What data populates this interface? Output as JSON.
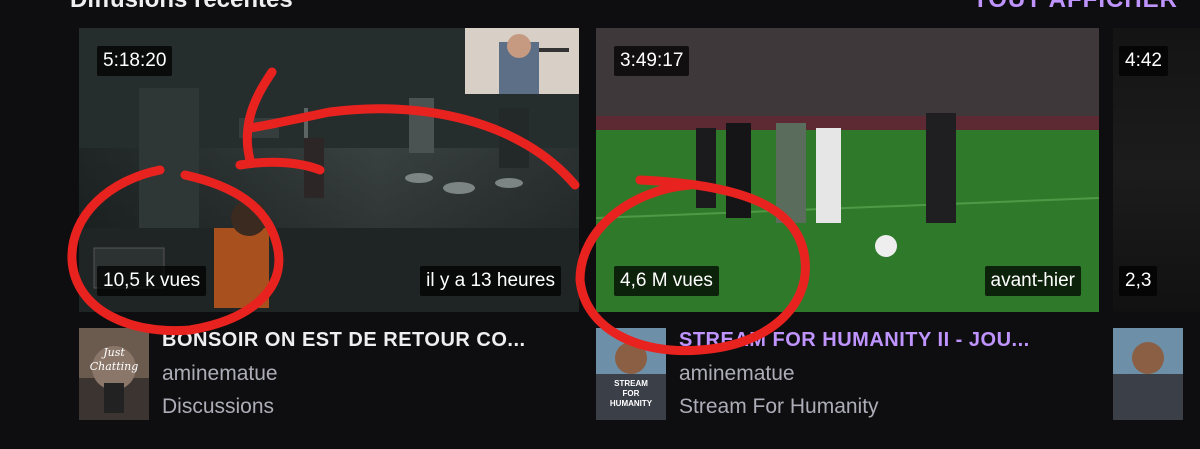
{
  "section": {
    "title": "Diffusions récentes",
    "see_all": "TOUT AFFICHER"
  },
  "videos": [
    {
      "duration": "5:18:20",
      "views": "10,5 k vues",
      "date": "il y a 13 heures",
      "title": "BONSOIR ON EST DE RETOUR CO...",
      "channel": "aminematue",
      "category": "Discussions",
      "box_art_text": "Just Chatting"
    },
    {
      "duration": "3:49:17",
      "views": "4,6 M vues",
      "date": "avant-hier",
      "title": "STREAM FOR HUMANITY II - JOU...",
      "channel": "aminematue",
      "category": "Stream For Humanity",
      "box_art_text": "STREAM FOR HUMANITY"
    },
    {
      "duration": "4:42",
      "views": "2,3"
    }
  ],
  "colors": {
    "background": "#0e0e10",
    "accent": "#bf94ff",
    "annotation": "#e8231f"
  }
}
